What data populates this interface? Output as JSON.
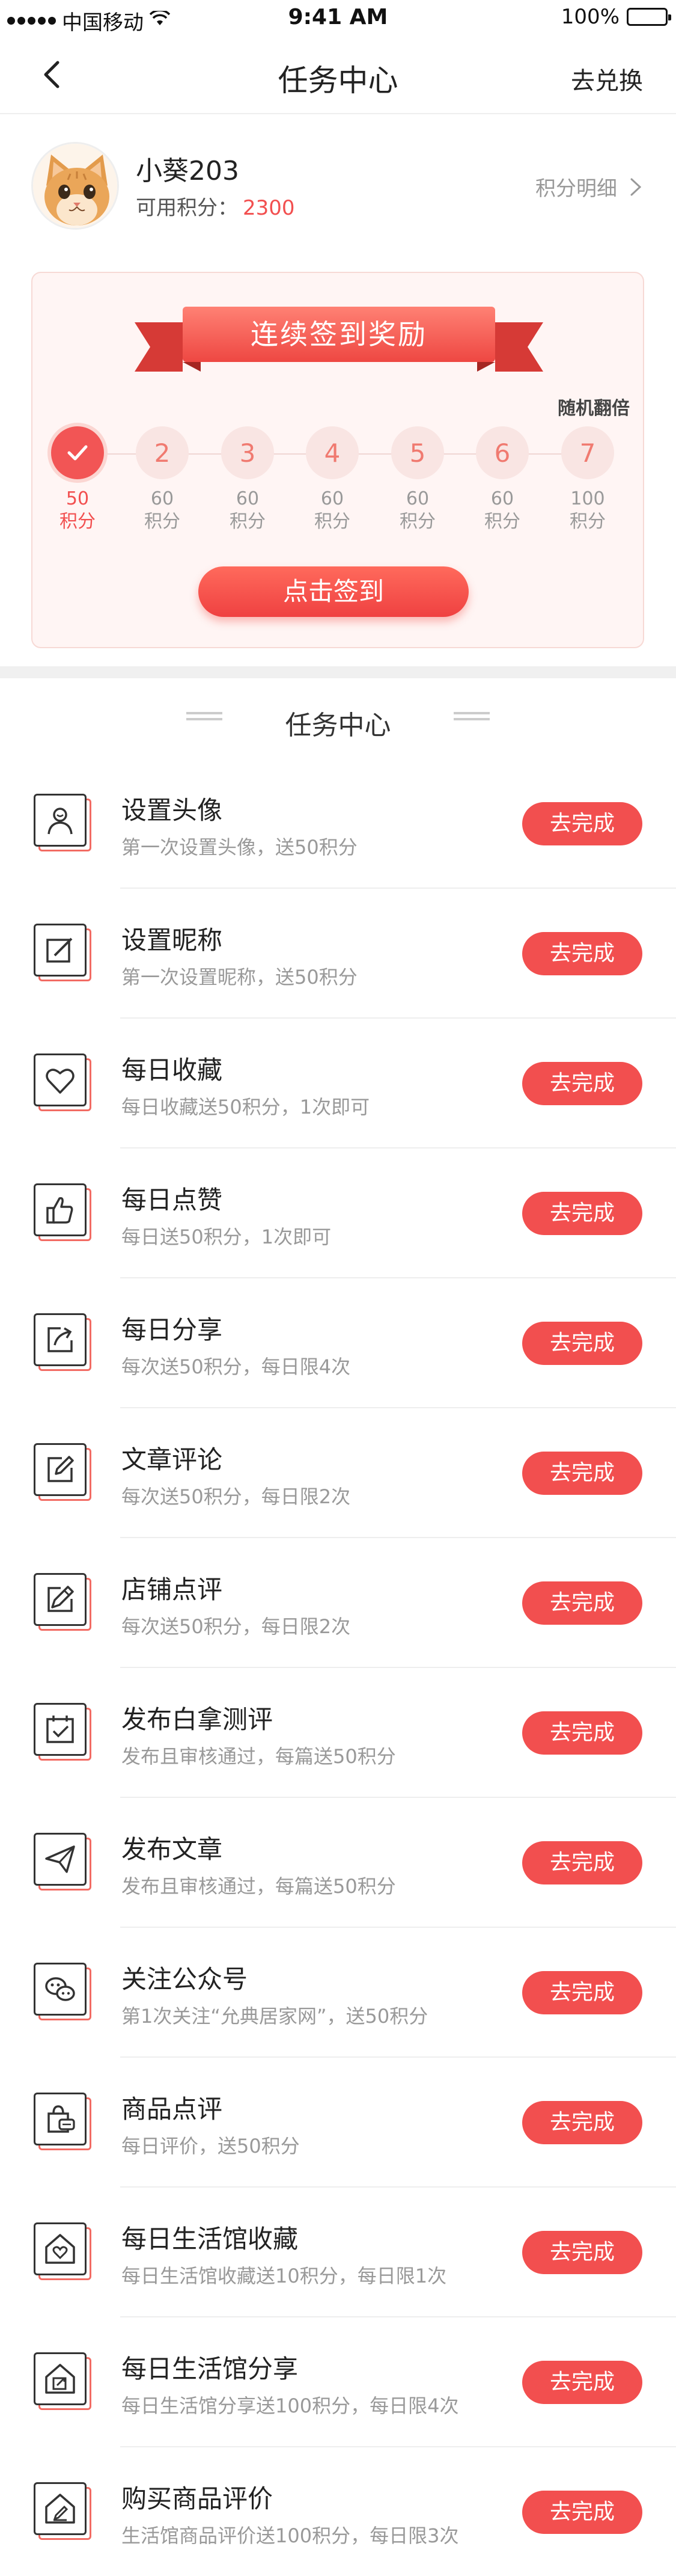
{
  "status_bar": {
    "carrier": "中国移动",
    "time": "9:41 AM",
    "battery": "100%"
  },
  "nav": {
    "title": "任务中心",
    "action": "去兑换"
  },
  "profile": {
    "username": "小葵203",
    "points_label": "可用积分：",
    "points_value": "2300",
    "detail_link": "积分明细"
  },
  "checkin": {
    "title": "连续签到奖励",
    "badge": "随机翻倍",
    "button": "点击签到",
    "days": [
      {
        "day": "1",
        "points": "50",
        "unit": "积分",
        "done": true
      },
      {
        "day": "2",
        "points": "60",
        "unit": "积分",
        "done": false
      },
      {
        "day": "3",
        "points": "60",
        "unit": "积分",
        "done": false
      },
      {
        "day": "4",
        "points": "60",
        "unit": "积分",
        "done": false
      },
      {
        "day": "5",
        "points": "60",
        "unit": "积分",
        "done": false
      },
      {
        "day": "6",
        "points": "60",
        "unit": "积分",
        "done": false
      },
      {
        "day": "7",
        "points": "100",
        "unit": "积分",
        "done": false
      }
    ]
  },
  "tasks_section": {
    "title": "任务中心",
    "items": [
      {
        "icon": "user-icon",
        "title": "设置头像",
        "desc": "第一次设置头像，送50积分",
        "button": "去完成"
      },
      {
        "icon": "edit-icon",
        "title": "设置昵称",
        "desc": "第一次设置昵称，送50积分",
        "button": "去完成"
      },
      {
        "icon": "heart-icon",
        "title": "每日收藏",
        "desc": "每日收藏送50积分，1次即可",
        "button": "去完成"
      },
      {
        "icon": "thumbs-up-icon",
        "title": "每日点赞",
        "desc": "每日送50积分，1次即可",
        "button": "去完成"
      },
      {
        "icon": "share-icon",
        "title": "每日分享",
        "desc": "每次送50积分，每日限4次",
        "button": "去完成"
      },
      {
        "icon": "comment-edit-icon",
        "title": "文章评论",
        "desc": "每次送50积分，每日限2次",
        "button": "去完成"
      },
      {
        "icon": "pen-icon",
        "title": "店铺点评",
        "desc": "每次送50积分，每日限2次",
        "button": "去完成"
      },
      {
        "icon": "calendar-check-icon",
        "title": "发布白拿测评",
        "desc": "发布且审核通过，每篇送50积分",
        "button": "去完成"
      },
      {
        "icon": "send-icon",
        "title": "发布文章",
        "desc": "发布且审核通过，每篇送50积分",
        "button": "去完成"
      },
      {
        "icon": "wechat-icon",
        "title": "关注公众号",
        "desc": "第1次关注“允典居家网”，送50积分",
        "button": "去完成"
      },
      {
        "icon": "bag-comment-icon",
        "title": "商品点评",
        "desc": "每日评价，送50积分",
        "button": "去完成"
      },
      {
        "icon": "house-heart-icon",
        "title": "每日生活馆收藏",
        "desc": "每日生活馆收藏送10积分，每日限1次",
        "button": "去完成"
      },
      {
        "icon": "house-share-icon",
        "title": "每日生活馆分享",
        "desc": "每日生活馆分享送100积分，每日限4次",
        "button": "去完成"
      },
      {
        "icon": "house-edit-icon",
        "title": "购买商品评价",
        "desc": "生活馆商品评价送100积分，每日限3次",
        "button": "去完成"
      }
    ]
  },
  "colors": {
    "accent": "#f24f4f",
    "card_bg": "#fff5f4",
    "muted": "#999999"
  }
}
